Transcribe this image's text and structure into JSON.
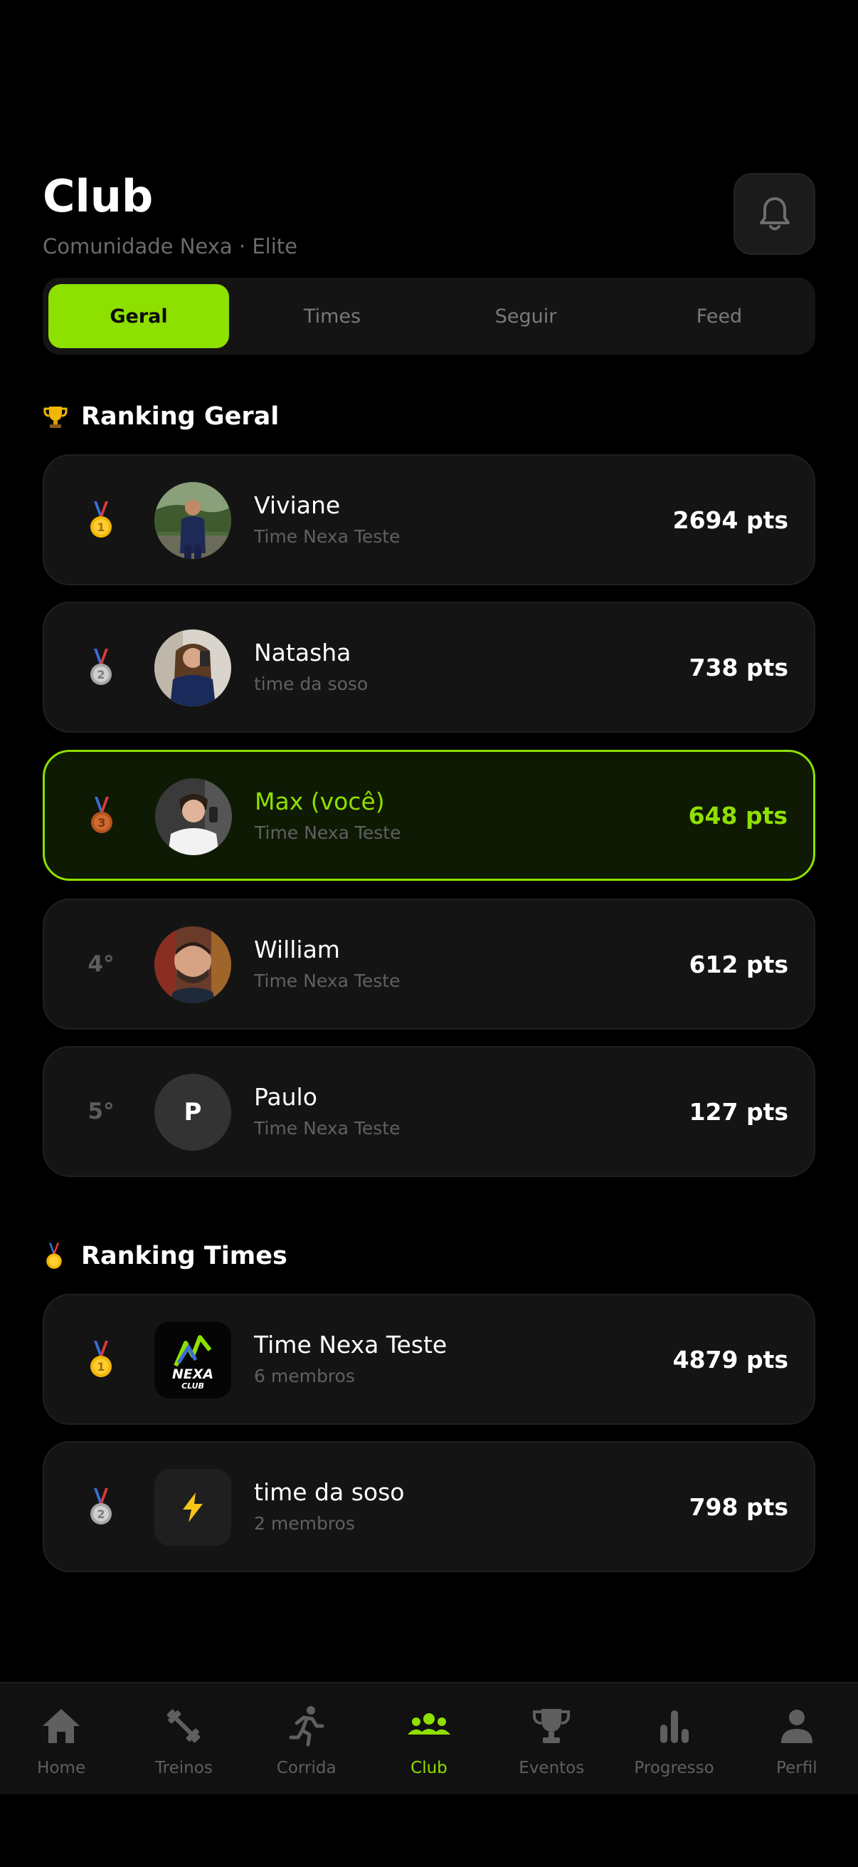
{
  "header": {
    "title": "Club",
    "subtitle": "Comunidade Nexa · Elite"
  },
  "tabs": [
    {
      "label": "Geral",
      "active": true
    },
    {
      "label": "Times",
      "active": false
    },
    {
      "label": "Seguir",
      "active": false
    },
    {
      "label": "Feed",
      "active": false
    }
  ],
  "ranking_geral": {
    "heading": "Ranking Geral",
    "icon": "trophy-icon",
    "items": [
      {
        "position": "1",
        "medal": "gold",
        "name": "Viviane",
        "team": "Time Nexa Teste",
        "points": "2694 pts",
        "avatar": "photo"
      },
      {
        "position": "2",
        "medal": "silver",
        "name": "Natasha",
        "team": "time da soso",
        "points": "738 pts",
        "avatar": "photo"
      },
      {
        "position": "3",
        "medal": "bronze",
        "name": "Max (você)",
        "team": "Time Nexa Teste",
        "points": "648 pts",
        "avatar": "photo",
        "current_user": true
      },
      {
        "position": "4°",
        "name": "William",
        "team": "Time Nexa Teste",
        "points": "612 pts",
        "avatar": "photo"
      },
      {
        "position": "5°",
        "name": "Paulo",
        "team": "Time Nexa Teste",
        "points": "127 pts",
        "avatar_letter": "P"
      }
    ]
  },
  "ranking_times": {
    "heading": "Ranking Times",
    "icon": "medal-icon",
    "items": [
      {
        "position": "1",
        "medal": "gold",
        "name": "Time Nexa Teste",
        "members": "6 membros",
        "points": "4879 pts",
        "logo_text": "NEXA",
        "logo_sub": "CLUB"
      },
      {
        "position": "2",
        "medal": "silver",
        "name": "time da soso",
        "members": "2 membros",
        "points": "798 pts",
        "logo_icon": "lightning-icon"
      }
    ]
  },
  "bottom_nav": [
    {
      "label": "Home",
      "icon": "home-icon"
    },
    {
      "label": "Treinos",
      "icon": "dumbbell-icon"
    },
    {
      "label": "Corrida",
      "icon": "running-icon"
    },
    {
      "label": "Club",
      "icon": "group-icon",
      "active": true
    },
    {
      "label": "Eventos",
      "icon": "trophy-icon"
    },
    {
      "label": "Progresso",
      "icon": "bar-chart-icon"
    },
    {
      "label": "Perfil",
      "icon": "person-icon"
    }
  ],
  "colors": {
    "accent": "#8ee000",
    "background": "#000000",
    "card": "#141414",
    "gold": "#f2b705",
    "silver": "#a6a6a6",
    "bronze": "#b4541f"
  }
}
